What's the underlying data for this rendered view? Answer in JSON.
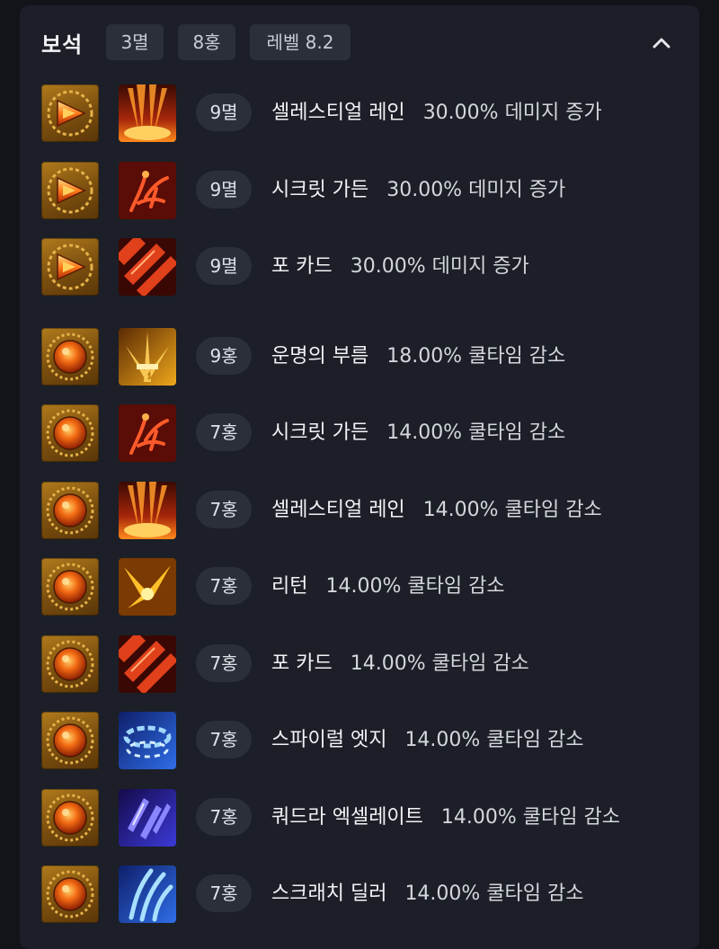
{
  "header": {
    "title": "보석",
    "chips": [
      "3멸",
      "8홍",
      "레벨 8.2"
    ],
    "collapse_icon": "chevron-up-icon"
  },
  "colors": {
    "panel": "#1c1f27",
    "chip": "#2b2f39",
    "text": "#f2f3f6"
  },
  "gems": [
    {
      "gem_icon": "flame-gem-icon",
      "skill_icon": "celestial-rain-icon",
      "level": "9멸",
      "skill": "셀레스티얼 레인",
      "effect": "30.00% 데미지 증가"
    },
    {
      "gem_icon": "flame-gem-icon",
      "skill_icon": "secret-garden-icon",
      "level": "9멸",
      "skill": "시크릿 가든",
      "effect": "30.00% 데미지 증가"
    },
    {
      "gem_icon": "flame-gem-icon",
      "skill_icon": "four-card-icon",
      "level": "9멸",
      "skill": "포 카드",
      "effect": "30.00% 데미지 증가"
    },
    {
      "gem_icon": "orb-gem-icon",
      "skill_icon": "call-of-destiny-icon",
      "level": "9홍",
      "skill": "운명의 부름",
      "effect": "18.00% 쿨타임 감소"
    },
    {
      "gem_icon": "orb-gem-icon",
      "skill_icon": "secret-garden-icon",
      "level": "7홍",
      "skill": "시크릿 가든",
      "effect": "14.00% 쿨타임 감소"
    },
    {
      "gem_icon": "orb-gem-icon",
      "skill_icon": "celestial-rain-icon",
      "level": "7홍",
      "skill": "셀레스티얼 레인",
      "effect": "14.00% 쿨타임 감소"
    },
    {
      "gem_icon": "orb-gem-icon",
      "skill_icon": "return-icon",
      "level": "7홍",
      "skill": "리턴",
      "effect": "14.00% 쿨타임 감소"
    },
    {
      "gem_icon": "orb-gem-icon",
      "skill_icon": "four-card-icon",
      "level": "7홍",
      "skill": "포 카드",
      "effect": "14.00% 쿨타임 감소"
    },
    {
      "gem_icon": "orb-gem-icon",
      "skill_icon": "spiral-edge-icon",
      "level": "7홍",
      "skill": "스파이럴 엣지",
      "effect": "14.00% 쿨타임 감소"
    },
    {
      "gem_icon": "orb-gem-icon",
      "skill_icon": "quadra-accelerate-icon",
      "level": "7홍",
      "skill": "쿼드라 엑셀레이트",
      "effect": "14.00% 쿨타임 감소"
    },
    {
      "gem_icon": "orb-gem-icon",
      "skill_icon": "scratch-dealer-icon",
      "level": "7홍",
      "skill": "스크래치 딜러",
      "effect": "14.00% 쿨타임 감소"
    }
  ]
}
